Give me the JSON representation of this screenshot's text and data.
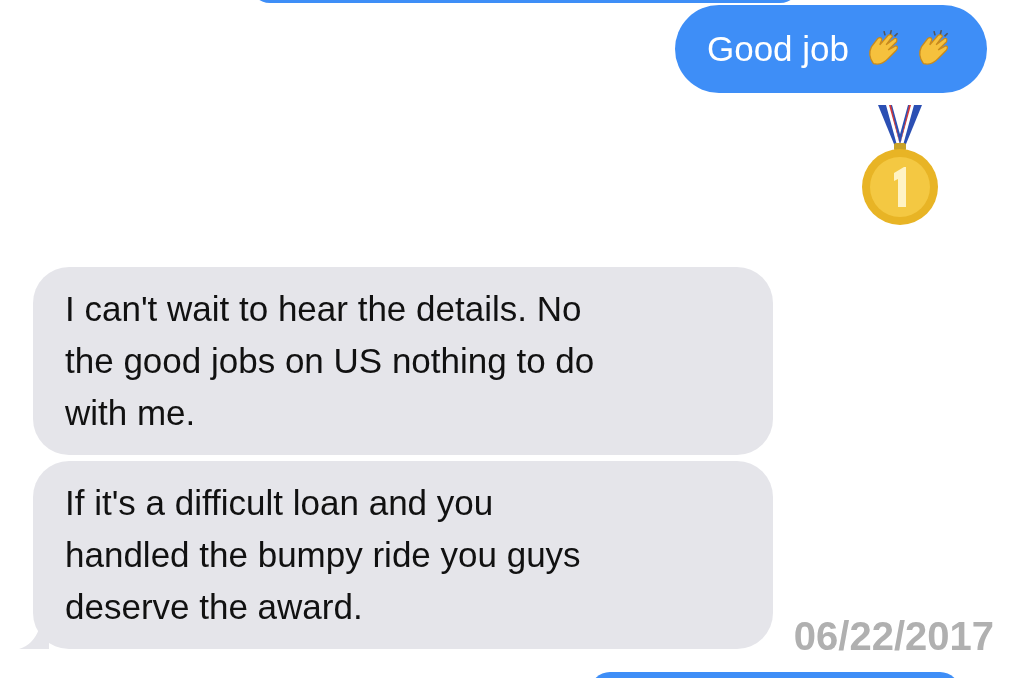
{
  "messages": [
    {
      "kind": "partial-sent"
    },
    {
      "kind": "sent",
      "text": "Good job",
      "emoji": [
        {
          "kind": "clap"
        },
        {
          "kind": "clap"
        }
      ]
    },
    {
      "kind": "medal"
    },
    {
      "kind": "received",
      "text": "I can't wait to hear the details. No\nthe good jobs on US nothing to do\nwith me.",
      "tail": false
    },
    {
      "kind": "received",
      "text": "If it's a difficult loan and you\nhandled the bumpy ride you guys\ndeserve the award.",
      "tail": true
    },
    {
      "kind": "partial-sent"
    }
  ],
  "date_stamp": "06/22/2017"
}
